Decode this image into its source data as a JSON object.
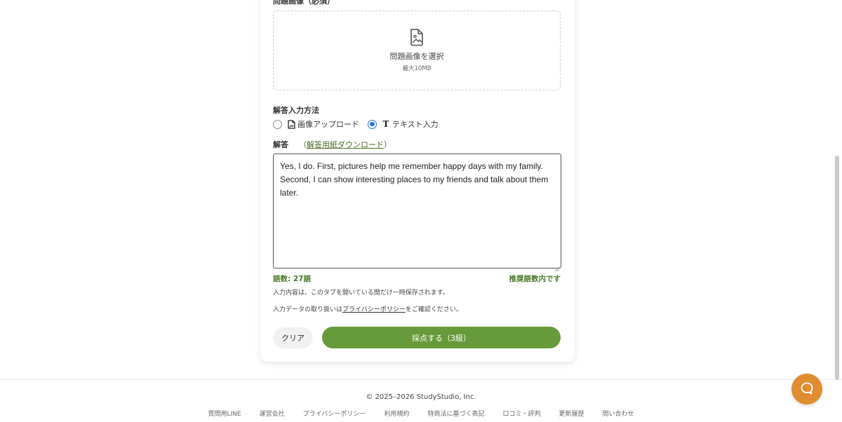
{
  "form": {
    "image_label": "問題画像（必須）",
    "dropzone": {
      "icon": "image-file-icon",
      "title": "問題画像を選択",
      "max_size": "最大10MB"
    },
    "method_label": "解答入力方法",
    "methods": [
      {
        "label": "画像アップロード",
        "icon": "file-image-icon",
        "selected": false
      },
      {
        "label": "テキスト入力",
        "icon": "text-t-icon",
        "selected": true
      }
    ],
    "answer_label": "解答",
    "download_link": "解答用紙ダウンロード",
    "answer_text": "Yes, I do. First, pictures help me remember happy days with my family. Second, I can show interesting places to my friends and talk about them later.",
    "word_count": "語数: 27語",
    "recommend_status": "推奨語数内です",
    "note_autosave": "入力内容は、このタブを開いている間だけ一時保存されます。",
    "note_privacy_prefix": "入力データの取り扱いは",
    "note_privacy_link": "プライバシーポリシー",
    "note_privacy_suffix": "をご確認ください。",
    "clear_button": "クリア",
    "submit_button": "採点する（3級）"
  },
  "footer": {
    "copyright": "© 2025–2026 StudyStudio, Inc.",
    "links": [
      "質問用LINE",
      "運営会社",
      "プライバシーポリシー",
      "利用規約",
      "特商法に基づく表記",
      "口コミ・評判",
      "更新履歴",
      "問い合わせ"
    ]
  },
  "colors": {
    "accent_green": "#679a3a",
    "text_green": "#4b7a27",
    "radio_blue": "#1a73e8",
    "chat_orange": "#e08d32"
  },
  "chat_button": {
    "icon": "chat-bubble-icon"
  }
}
